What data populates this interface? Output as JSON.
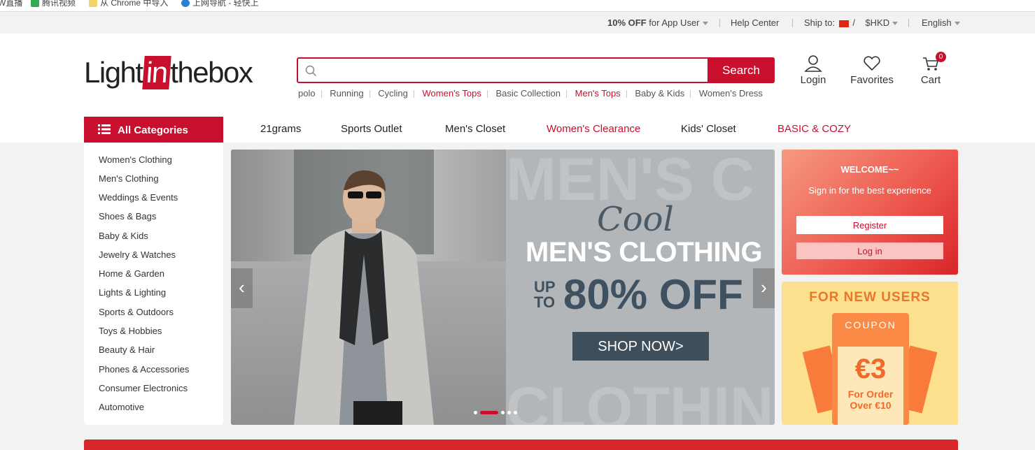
{
  "bookmarks": [
    {
      "label": "W直播",
      "color": "#f2c23a"
    },
    {
      "label": "腾讯视频",
      "color": "#33aa55"
    },
    {
      "label": "从 Chrome 中导入",
      "color": "#f2d46a"
    },
    {
      "label": "上网导航 - 轻快上",
      "color": "#2a7fd4"
    }
  ],
  "topbar": {
    "promo_bold": "10% OFF",
    "promo_rest": "for App User",
    "help": "Help Center",
    "ship_label": "Ship to:",
    "ship_sep": "/",
    "currency": "$HKD",
    "language": "English"
  },
  "logo": {
    "pre": "Light",
    "mid": "in",
    "post": "thebox"
  },
  "search": {
    "placeholder": "",
    "button": "Search"
  },
  "hot_searches": [
    {
      "text": "polo",
      "highlight": false
    },
    {
      "text": "Running",
      "highlight": false
    },
    {
      "text": "Cycling",
      "highlight": false
    },
    {
      "text": "Women's Tops",
      "highlight": true
    },
    {
      "text": "Basic Collection",
      "highlight": false
    },
    {
      "text": "Men's Tops",
      "highlight": true
    },
    {
      "text": "Baby & Kids",
      "highlight": false
    },
    {
      "text": "Women's Dress",
      "highlight": false
    }
  ],
  "header_icons": {
    "login": "Login",
    "favorites": "Favorites",
    "cart": "Cart",
    "cart_count": "0"
  },
  "all_categories": "All Categories",
  "nav": [
    {
      "label": "21grams",
      "highlight": false
    },
    {
      "label": "Sports Outlet",
      "highlight": false
    },
    {
      "label": "Men's Closet",
      "highlight": false
    },
    {
      "label": "Women's Clearance",
      "highlight": true
    },
    {
      "label": "Kids' Closet",
      "highlight": false
    },
    {
      "label": "BASIC & COZY",
      "highlight": true
    }
  ],
  "categories": [
    "Women's Clothing",
    "Men's Clothing",
    "Weddings & Events",
    "Shoes & Bags",
    "Baby & Kids",
    "Jewelry & Watches",
    "Home & Garden",
    "Lights & Lighting",
    "Sports & Outdoors",
    "Toys & Hobbies",
    "Beauty & Hair",
    "Phones & Accessories",
    "Consumer Electronics",
    "Automotive"
  ],
  "banner": {
    "bg_top": "MEN'S C",
    "bg_bottom": "CLOTHIN",
    "script": "Cool",
    "title": "MEN'S CLOTHING",
    "up": "UP",
    "to": "TO",
    "off": "80% OFF",
    "cta": "SHOP NOW>",
    "slides_total": 5,
    "active_slide": 2
  },
  "welcome": {
    "title": "WELCOME~~",
    "subtitle": "Sign in for the best experience",
    "register": "Register",
    "login": "Log in"
  },
  "coupon": {
    "headline": "FOR NEW USERS",
    "label": "COUPON",
    "amount": "€3",
    "line1": "For Order",
    "line2": "Over €10"
  },
  "colors": {
    "brand": "#c8102e",
    "cta_dark": "#3e4e5b",
    "coupon_orange": "#f06a2a"
  }
}
